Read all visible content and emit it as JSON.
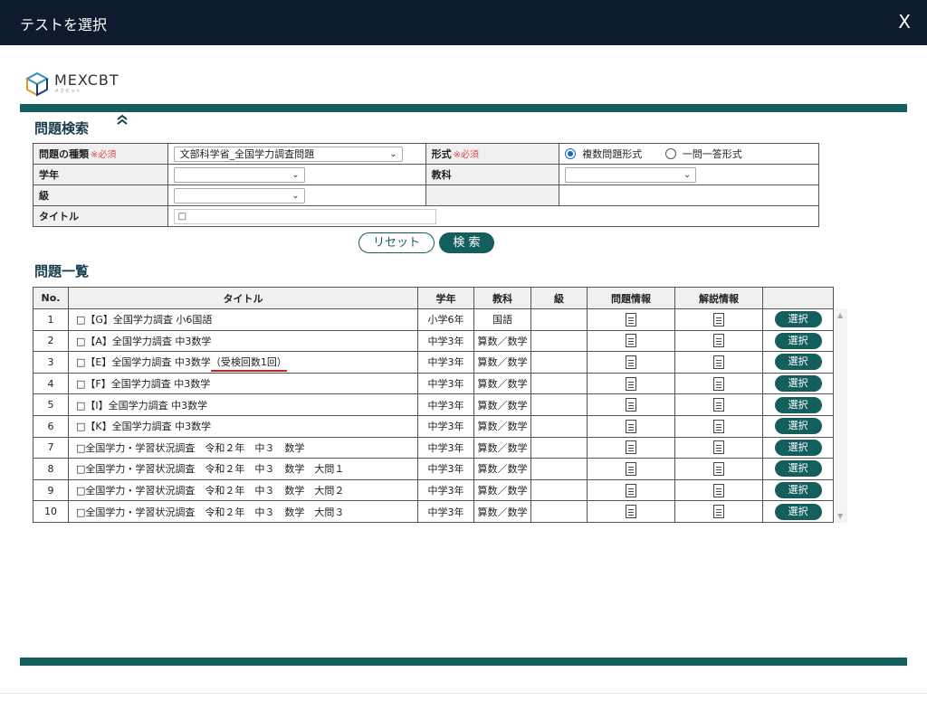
{
  "window": {
    "title": "テストを選択",
    "close": "X"
  },
  "logo": {
    "brand": "MEXCBT",
    "sub": "メクビット"
  },
  "search": {
    "heading": "問題検索",
    "collapse_icon": "⌃",
    "type_label": "問題の種類",
    "required": "※必須",
    "type_value": "文部科学省_全国学力調査問題",
    "format_label": "形式",
    "format_options": [
      "複数問題形式",
      "一問一答形式"
    ],
    "format_selected": "複数問題形式",
    "grade_label": "学年",
    "subject_label": "教科",
    "level_label": "級",
    "title_label": "タイトル",
    "title_checkbox": "□"
  },
  "buttons": {
    "reset": "リセット",
    "search": "検 索"
  },
  "list": {
    "heading": "問題一覧",
    "columns": [
      "No.",
      "タイトル",
      "学年",
      "教科",
      "級",
      "問題情報",
      "解説情報",
      ""
    ],
    "select_label": "選択",
    "rows": [
      {
        "no": "1",
        "title": "□【G】全国学力調査 小6国語",
        "highlight": "",
        "grade": "小学6年",
        "subject": "国語",
        "level": ""
      },
      {
        "no": "2",
        "title": "□【A】全国学力調査 中3数学",
        "highlight": "",
        "grade": "中学3年",
        "subject": "算数／数学",
        "level": ""
      },
      {
        "no": "3",
        "title": "□【E】全国学力調査 中3数学",
        "highlight": "（受検回数1回）",
        "grade": "中学3年",
        "subject": "算数／数学",
        "level": ""
      },
      {
        "no": "4",
        "title": "□【F】全国学力調査 中3数学",
        "highlight": "",
        "grade": "中学3年",
        "subject": "算数／数学",
        "level": ""
      },
      {
        "no": "5",
        "title": "□【I】全国学力調査 中3数学",
        "highlight": "",
        "grade": "中学3年",
        "subject": "算数／数学",
        "level": ""
      },
      {
        "no": "6",
        "title": "□【K】全国学力調査 中3数学",
        "highlight": "",
        "grade": "中学3年",
        "subject": "算数／数学",
        "level": ""
      },
      {
        "no": "7",
        "title": "□全国学力・学習状況調査　令和２年　中３　数学",
        "highlight": "",
        "grade": "中学3年",
        "subject": "算数／数学",
        "level": ""
      },
      {
        "no": "8",
        "title": "□全国学力・学習状況調査　令和２年　中３　数学　大問１",
        "highlight": "",
        "grade": "中学3年",
        "subject": "算数／数学",
        "level": ""
      },
      {
        "no": "9",
        "title": "□全国学力・学習状況調査　令和２年　中３　数学　大問２",
        "highlight": "",
        "grade": "中学3年",
        "subject": "算数／数学",
        "level": ""
      },
      {
        "no": "10",
        "title": "□全国学力・学習状況調査　令和２年　中３　数学　大問３",
        "highlight": "",
        "grade": "中学3年",
        "subject": "算数／数学",
        "level": ""
      }
    ]
  },
  "colors": {
    "header_bg": "#0e1a2e",
    "accent": "#155e5e",
    "required": "#e04a4a",
    "radio": "#1a66c8",
    "highlight_underline": "#d42020"
  },
  "icons": {
    "doc": "document-icon",
    "chevron": "chevron-down-icon",
    "collapse": "chevron-up-icon"
  }
}
